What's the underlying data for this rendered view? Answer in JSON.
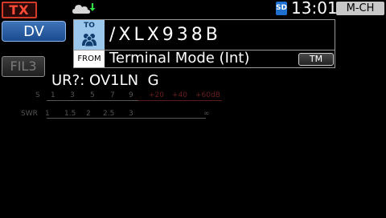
{
  "status_bar": {
    "tx_label": "TX",
    "cloud_icon": "cloud-download-icon",
    "sd_label": "SD",
    "clock": "13:01",
    "mode_label": "M-CH"
  },
  "left_buttons": {
    "mode_button": "DV",
    "filter_button": "FIL3"
  },
  "call_panel": {
    "to_label": "TO",
    "to_icon": "group-call-icon",
    "to_value": "/XLX938B",
    "from_label": "FROM",
    "from_value": "Terminal Mode (Int)",
    "from_button": "TM"
  },
  "ur_line": "UR?: OV1LN  G",
  "meter": {
    "s_label": "S",
    "s_ticks": [
      "1",
      "3",
      "5",
      "7",
      "9"
    ],
    "s_over_ticks": [
      "+20",
      "+40",
      "+60dB"
    ],
    "swr_label": "SWR",
    "swr_ticks": [
      "1",
      "1.5",
      "2",
      "2.5",
      "3",
      "∞"
    ]
  },
  "colors": {
    "background": "#000000",
    "tx": "#ff4a36",
    "dv_button": "#2d5fa3",
    "to_box": "#9cc7ec"
  }
}
